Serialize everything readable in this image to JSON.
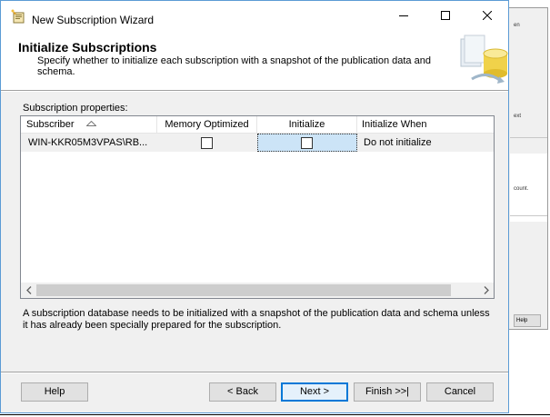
{
  "window": {
    "title": "New Subscription Wizard"
  },
  "header": {
    "title": "Initialize Subscriptions",
    "description": "Specify whether to initialize each subscription with a snapshot of the publication data and schema."
  },
  "properties": {
    "label": "Subscription properties:",
    "columns": {
      "subscriber": "Subscriber",
      "memory_optimized": "Memory Optimized",
      "initialize": "Initialize",
      "initialize_when": "Initialize When"
    },
    "rows": [
      {
        "subscriber": "WIN-KKR05M3VPAS\\RB...",
        "memory_optimized": false,
        "initialize": false,
        "initialize_when": "Do not initialize"
      }
    ]
  },
  "info": {
    "text": "A subscription database needs to be initialized with a snapshot of the publication data and schema unless it has already been specially prepared for the subscription."
  },
  "buttons": {
    "help": "Help",
    "back": "< Back",
    "next": "Next >",
    "finish": "Finish >>|",
    "cancel": "Cancel"
  },
  "background_window": {
    "text_1": "en",
    "text_2": "ext",
    "text_3": "count.",
    "help": "Help"
  },
  "colors": {
    "selection": "#cce4f7",
    "accent": "#0078d7",
    "dialog_bg": "#f0f0f0",
    "border": "#5b9bd5"
  }
}
